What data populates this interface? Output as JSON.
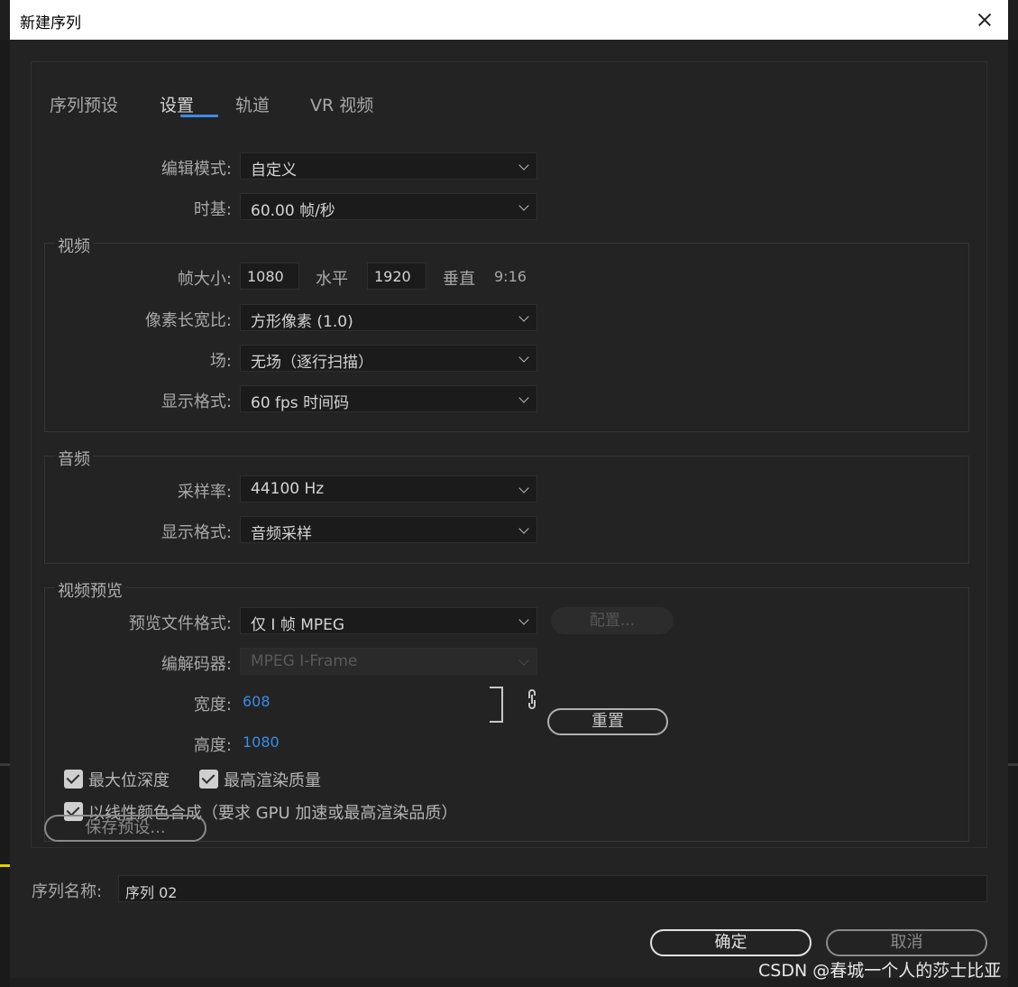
{
  "window": {
    "title": "新建序列"
  },
  "tabs": [
    {
      "label": "序列预设"
    },
    {
      "label": "设置"
    },
    {
      "label": "轨道"
    },
    {
      "label": "VR 视频"
    }
  ],
  "edit_mode": {
    "label": "编辑模式:",
    "value": "自定义"
  },
  "timebase": {
    "label": "时基:",
    "value": "60.00  帧/秒"
  },
  "video": {
    "group_title": "视频",
    "frame_size_label": "帧大小:",
    "width_value": "1080",
    "horizontal_label": "水平",
    "height_value": "1920",
    "vertical_label": "垂直",
    "aspect": "9:16",
    "pixel_aspect_label": "像素长宽比:",
    "pixel_aspect_value": "方形像素 (1.0)",
    "field_label": "场:",
    "field_value": "无场（逐行扫描）",
    "display_format_label": "显示格式:",
    "display_format_value": "60 fps 时间码"
  },
  "audio": {
    "group_title": "音频",
    "sample_rate_label": "采样率:",
    "sample_rate_value": "44100 Hz",
    "display_format_label": "显示格式:",
    "display_format_value": "音频采样"
  },
  "preview": {
    "group_title": "视频预览",
    "file_format_label": "预览文件格式:",
    "file_format_value": "仅 I 帧 MPEG",
    "configure_label": "配置...",
    "codec_label": "编解码器:",
    "codec_value": "MPEG I-Frame",
    "width_label": "宽度:",
    "width_value": "608",
    "height_label": "高度:",
    "height_value": "1080",
    "reset_label": "重置",
    "max_bit_depth": "最大位深度",
    "max_render_quality": "最高渲染质量",
    "linear_color": "以线性颜色合成（要求 GPU 加速或最高渲染品质）"
  },
  "save_preset_label": "保存预设...",
  "sequence_name": {
    "label": "序列名称:",
    "value": "序列 02"
  },
  "ok_label": "确定",
  "cancel_label": "取消",
  "watermark": "CSDN @春城一个人的莎士比亚",
  "colors": {
    "accent": "#3b8ce8",
    "dialog_bg": "#232323",
    "field_bg": "#1b1b1b"
  }
}
